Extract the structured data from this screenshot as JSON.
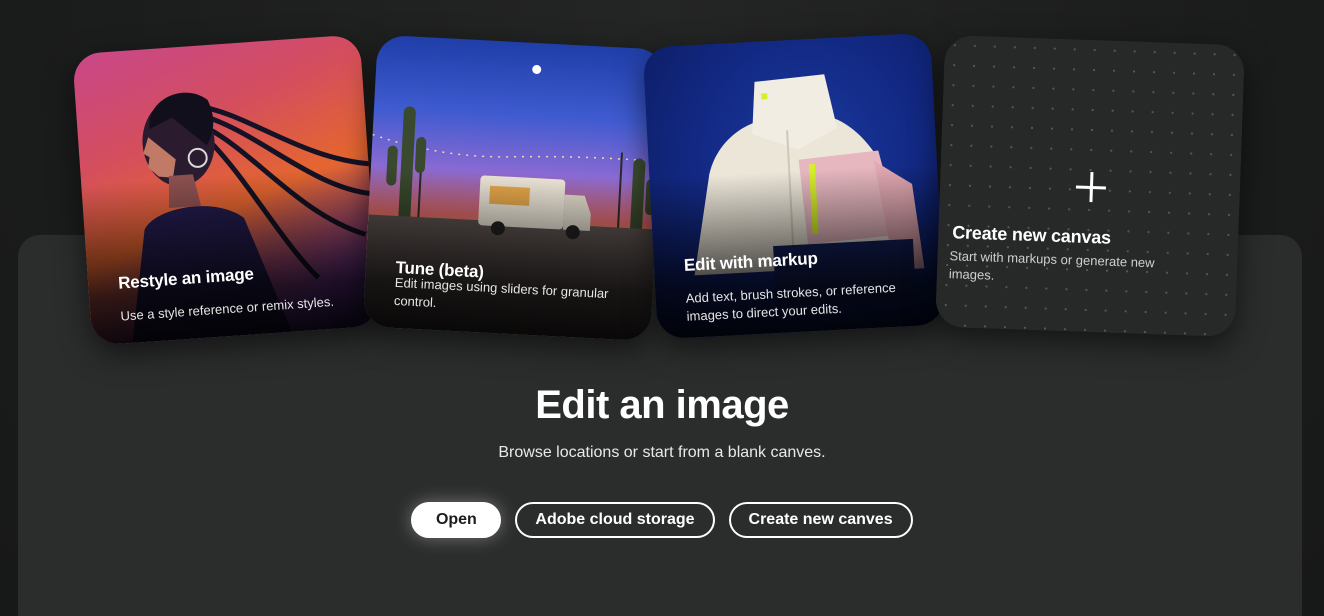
{
  "cards": [
    {
      "title": "Restyle an image",
      "description": "Use a style reference or remix styles."
    },
    {
      "title": "Tune (beta)",
      "description": "Edit images using sliders for granular control."
    },
    {
      "title": "Edit with markup",
      "description": "Add text, brush strokes, or reference images to direct your edits."
    },
    {
      "title": "Create new canvas",
      "description": "Start with markups or generate new images.",
      "icon": "plus-icon"
    }
  ],
  "main": {
    "title": "Edit an image",
    "subtitle": "Browse locations or start from a blank canves."
  },
  "buttons": {
    "open": "Open",
    "cloud": "Adobe cloud storage",
    "create": "Create new canves"
  },
  "colors": {
    "background": "#1b1c1c",
    "panel": "#2b2c2c",
    "primary_button": "#ffffff"
  }
}
